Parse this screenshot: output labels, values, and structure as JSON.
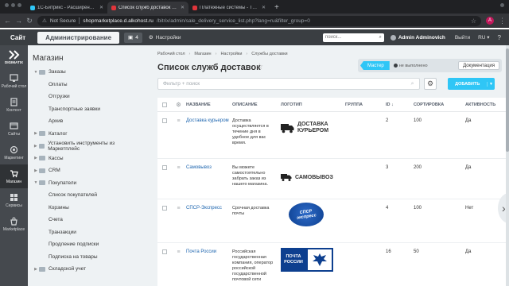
{
  "browser": {
    "tabs": [
      {
        "title": "1С-Битрикс - Расширение ф",
        "active": false
      },
      {
        "title": "Список служб доставок - Тес",
        "active": true
      },
      {
        "title": "Платежные системы - Тестов",
        "active": false
      }
    ],
    "security": "Not Secure",
    "url_host": "shopmarketplace.d.alkohost.ru",
    "url_path": "/bitrix/admin/sale_delivery_service_list.php?lang=ru&filter_group=0",
    "profile_initial": "A"
  },
  "bxpanel": {
    "site": "Сайт",
    "admin": "Администрирование",
    "notify_count": "4",
    "settings": "Настройки",
    "search_placeholder": "поиск...",
    "user": "Admin Adminovich",
    "exit": "Выйти",
    "lang": "RU"
  },
  "iconbar": {
    "logo": "DIGIMATIX",
    "items": [
      {
        "label": "Рабочий стол",
        "icon": "desktop-icon"
      },
      {
        "label": "Контент",
        "icon": "content-icon"
      },
      {
        "label": "Сайты",
        "icon": "sites-icon"
      },
      {
        "label": "Маркетинг",
        "icon": "marketing-icon"
      },
      {
        "label": "Магазин",
        "icon": "cart-icon",
        "active": true
      },
      {
        "label": "Сервисы",
        "icon": "services-icon"
      },
      {
        "label": "Marketplace",
        "icon": "marketplace-icon"
      }
    ]
  },
  "submenu": {
    "title": "Магазин",
    "items": [
      {
        "label": "Заказы",
        "level": 1,
        "expanded": true
      },
      {
        "label": "Оплаты",
        "level": 2
      },
      {
        "label": "Отгрузки",
        "level": 2
      },
      {
        "label": "Транспортные заявки",
        "level": 2
      },
      {
        "label": "Архив",
        "level": 2
      },
      {
        "label": "Каталог",
        "level": 1
      },
      {
        "label": "Установить инструменты из Маркетплейс",
        "level": 1
      },
      {
        "label": "Кассы",
        "level": 1
      },
      {
        "label": "CRM",
        "level": 1
      },
      {
        "label": "Покупатели",
        "level": 1,
        "expanded": true
      },
      {
        "label": "Список покупателей",
        "level": 2
      },
      {
        "label": "Корзины",
        "level": 2
      },
      {
        "label": "Счета",
        "level": 2
      },
      {
        "label": "Транзакции",
        "level": 2
      },
      {
        "label": "Продление подписки",
        "level": 2
      },
      {
        "label": "Подписка на товары",
        "level": 2
      },
      {
        "label": "Складской учет",
        "level": 1
      }
    ]
  },
  "main": {
    "breadcrumb": [
      "Рабочий стол",
      "Магазин",
      "Настройки",
      "Службы доставки"
    ],
    "title": "Список служб доставок",
    "master": "Мастер",
    "status": "не выполнено",
    "docs": "Документация",
    "filter_placeholder": "Фильтр + поиск",
    "add": "ДОБАВИТЬ",
    "columns": [
      "НАЗВАНИЕ",
      "ОПИСАНИЕ",
      "ЛОГОТИП",
      "ГРУППА",
      "ID",
      "СОРТИРОВКА",
      "АКТИВНОСТЬ"
    ],
    "rows": [
      {
        "name": "Доставка курьером",
        "desc": "Доставка осуществляется в течение дня в удобное для вас время.",
        "logo": "ДОСТАВКА КУРЬЕРОМ",
        "group": "",
        "id": "2",
        "sort": "100",
        "active": "Да"
      },
      {
        "name": "Самовывоз",
        "desc": "Вы можете самостоятельно забрать заказ из нашего магазина.",
        "logo": "САМОВЫВОЗ",
        "group": "",
        "id": "3",
        "sort": "200",
        "active": "Да"
      },
      {
        "name": "СПСР-Экспресс",
        "desc": "Срочная доставка почты",
        "logo": "СПСР экспресс",
        "group": "",
        "id": "4",
        "sort": "100",
        "active": "Нет"
      },
      {
        "name": "Почта России",
        "desc": "Российская государственная компания, оператор российской государственной почтовой сети",
        "logo": "ПОЧТА РОССИИ",
        "group": "",
        "id": "16",
        "sort": "50",
        "active": "Да"
      }
    ]
  },
  "colors": {
    "accent": "#2fc6f6",
    "panel": "#3a3e42",
    "sidebar": "#45494e",
    "link": "#2067b0"
  }
}
